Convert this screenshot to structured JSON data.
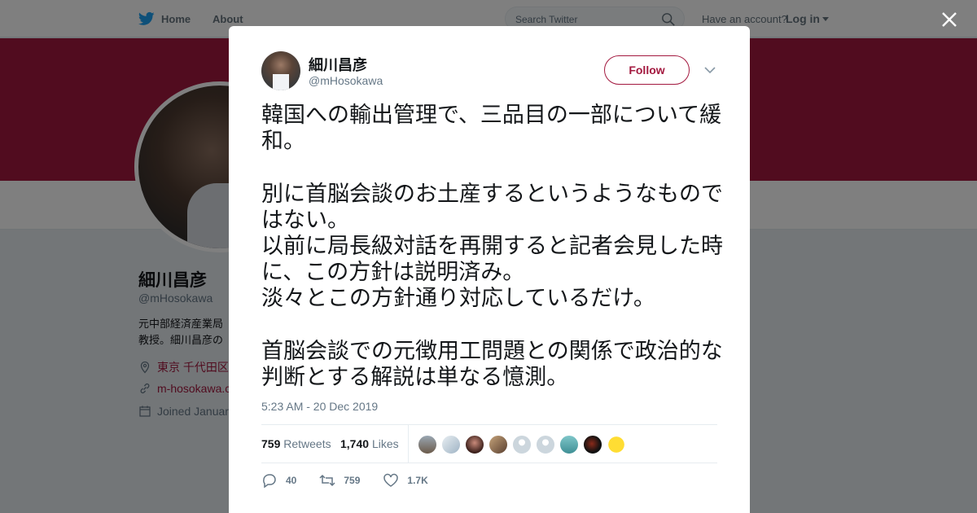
{
  "topbar": {
    "home_label": "Home",
    "about_label": "About",
    "search_placeholder": "Search Twitter",
    "account_text": "Have an account?",
    "login_label": "Log in"
  },
  "profile_bg": {
    "name": "細川昌彦",
    "handle": "@mHosokawa",
    "bio_line1": "元中部経済産業局",
    "bio_line2": "教授。細川昌彦の",
    "location": "東京 千代田区",
    "website": "m-hosokawa.c",
    "joined": "Joined Januar",
    "brand_color": "#a3193f"
  },
  "tweet": {
    "author_name": "細川昌彦",
    "author_handle": "@mHosokawa",
    "follow_label": "Follow",
    "text": "韓国への輸出管理で、三品目の一部について緩和。\n\n別に首脳会談のお土産するというようなものではない。\n以前に局長級対話を再開すると記者会見した時に、この方針は説明済み。\n淡々とこの方針通り対応しているだけ。\n\n首脳会談での元徴用工問題との関係で政治的な判断とする解説は単なる憶測。",
    "timestamp": "5:23 AM - 20 Dec 2019",
    "retweets_count": "759",
    "retweets_label": "Retweets",
    "likes_count": "1,740",
    "likes_label": "Likes",
    "reply_count": "40",
    "retweet_count": "759",
    "like_count": "1.7K"
  }
}
